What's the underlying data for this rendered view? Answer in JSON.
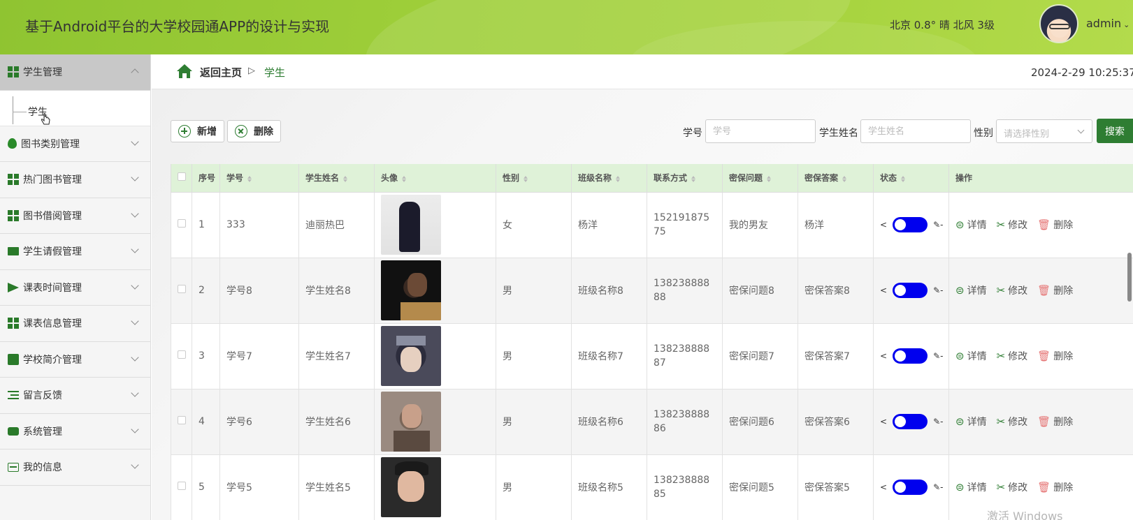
{
  "header": {
    "title": "基于Android平台的大学校园通APP的设计与实现",
    "weather": "北京  0.8°  晴  北风  3级",
    "username": "admin"
  },
  "sidebar": {
    "items": [
      {
        "label": "学生管理",
        "icon": "grid-icon",
        "expanded": true
      },
      {
        "label": "图书类别管理",
        "icon": "bulb-icon"
      },
      {
        "label": "热门图书管理",
        "icon": "grid-icon"
      },
      {
        "label": "图书借阅管理",
        "icon": "grid-icon"
      },
      {
        "label": "学生请假管理",
        "icon": "monitor-icon"
      },
      {
        "label": "课表时间管理",
        "icon": "plane-icon"
      },
      {
        "label": "课表信息管理",
        "icon": "grid-icon"
      },
      {
        "label": "学校简介管理",
        "icon": "clipboard-icon"
      },
      {
        "label": "留言反馈",
        "icon": "list-icon"
      },
      {
        "label": "系统管理",
        "icon": "gear-icon"
      },
      {
        "label": "我的信息",
        "icon": "card-icon"
      }
    ],
    "submenu": {
      "label": "学生"
    }
  },
  "breadcrumb": {
    "home": "返回主页",
    "separator": "▷",
    "current": "学生"
  },
  "datetime": "2024-2-29 10:25:37",
  "toolbar": {
    "add_label": "新增",
    "delete_label": "删除"
  },
  "filters": {
    "student_no_label": "学号",
    "student_no_placeholder": "学号",
    "student_name_label": "学生姓名",
    "student_name_placeholder": "学生姓名",
    "gender_label": "性别",
    "gender_placeholder": "请选择性别",
    "search_label": "搜索"
  },
  "table": {
    "headers": [
      "序号",
      "学号",
      "学生姓名",
      "头像",
      "性别",
      "班级名称",
      "联系方式",
      "密保问题",
      "密保答案",
      "状态",
      "操作"
    ],
    "rows": [
      {
        "idx": "1",
        "no": "333",
        "name": "迪丽热巴",
        "gender": "女",
        "class": "杨洋",
        "phone": "15219187575",
        "question": "我的男友",
        "answer": "杨洋"
      },
      {
        "idx": "2",
        "no": "学号8",
        "name": "学生姓名8",
        "gender": "男",
        "class": "班级名称8",
        "phone": "13823888888",
        "question": "密保问题8",
        "answer": "密保答案8"
      },
      {
        "idx": "3",
        "no": "学号7",
        "name": "学生姓名7",
        "gender": "男",
        "class": "班级名称7",
        "phone": "13823888887",
        "question": "密保问题7",
        "answer": "密保答案7"
      },
      {
        "idx": "4",
        "no": "学号6",
        "name": "学生姓名6",
        "gender": "男",
        "class": "班级名称6",
        "phone": "13823888886",
        "question": "密保问题6",
        "answer": "密保答案6"
      },
      {
        "idx": "5",
        "no": "学号5",
        "name": "学生姓名5",
        "gender": "男",
        "class": "班级名称5",
        "phone": "13823888885",
        "question": "密保问题5",
        "answer": "密保答案5"
      }
    ],
    "ops": {
      "detail": "详情",
      "edit": "修改",
      "delete": "删除"
    },
    "status_share_glyph": "<",
    "status_edit_glyph": "✎-"
  },
  "colors": {
    "accent": "#2e7d32",
    "header_green": "#9fcf3a",
    "table_header": "#dff2d8",
    "switch_on": "#0000ee"
  },
  "watermark": "激活 Windows"
}
